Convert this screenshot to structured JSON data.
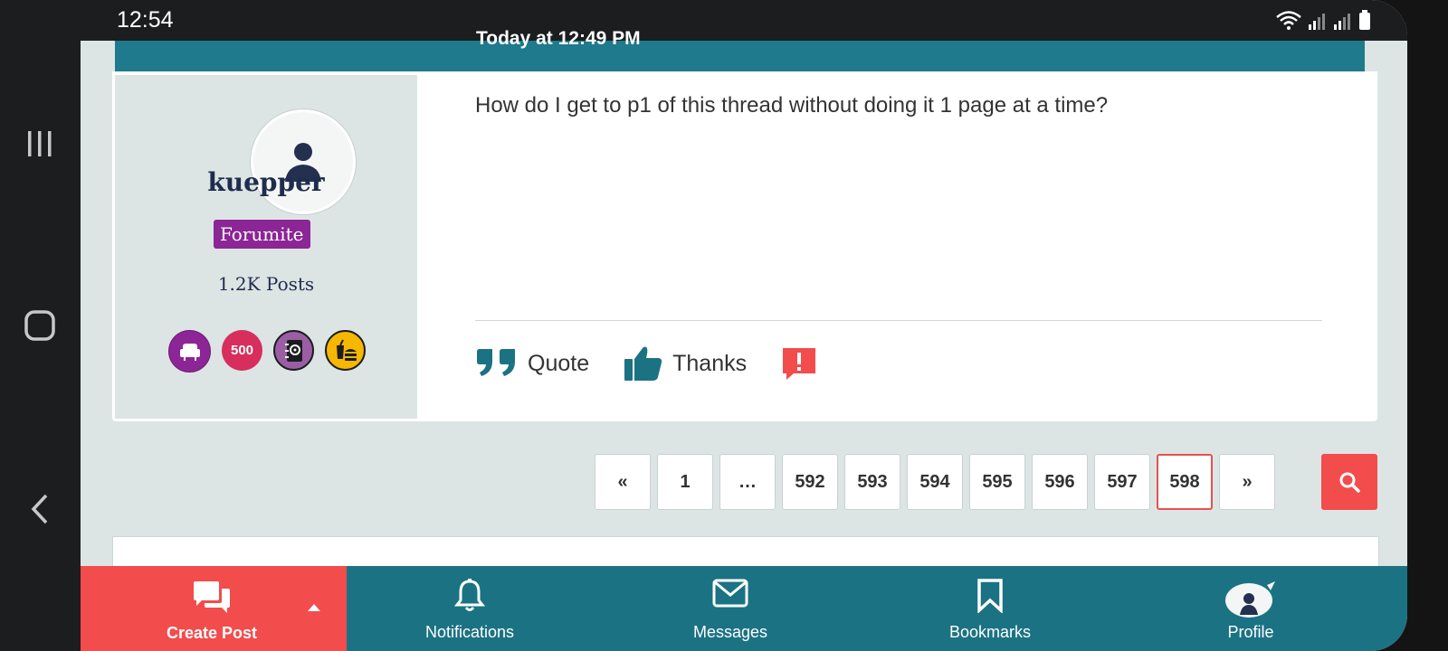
{
  "status_bar": {
    "time": "12:54"
  },
  "post": {
    "date": "Today at 12:49 PM",
    "author": {
      "name": "kuepper",
      "role": "Forumite",
      "post_count": "1.2K Posts"
    },
    "badges": [
      {
        "icon": "armchair-icon",
        "color": "#8c2595"
      },
      {
        "text": "500",
        "color": "#d72e5d"
      },
      {
        "icon": "contact-book-icon",
        "color": "#9b5ea4"
      },
      {
        "icon": "fast-food-icon",
        "color": "#f5b700"
      }
    ],
    "body": "How do I get to p1 of this thread without doing it 1 page at a time?",
    "actions": {
      "quote": "Quote",
      "thanks": "Thanks"
    }
  },
  "pagination": {
    "prev": "«",
    "pages": [
      "1",
      "…",
      "592",
      "593",
      "594",
      "595",
      "596",
      "597",
      "598"
    ],
    "current": "598",
    "next": "»"
  },
  "bottom_nav": {
    "create_post": "Create Post",
    "notifications": "Notifications",
    "messages": "Messages",
    "bookmarks": "Bookmarks",
    "profile": "Profile"
  },
  "colors": {
    "teal": "#1b7283",
    "header_teal": "#1e7a8c",
    "accent_red": "#f24c4c",
    "role_purple": "#8c2595",
    "page_bg": "#dde4e4"
  }
}
